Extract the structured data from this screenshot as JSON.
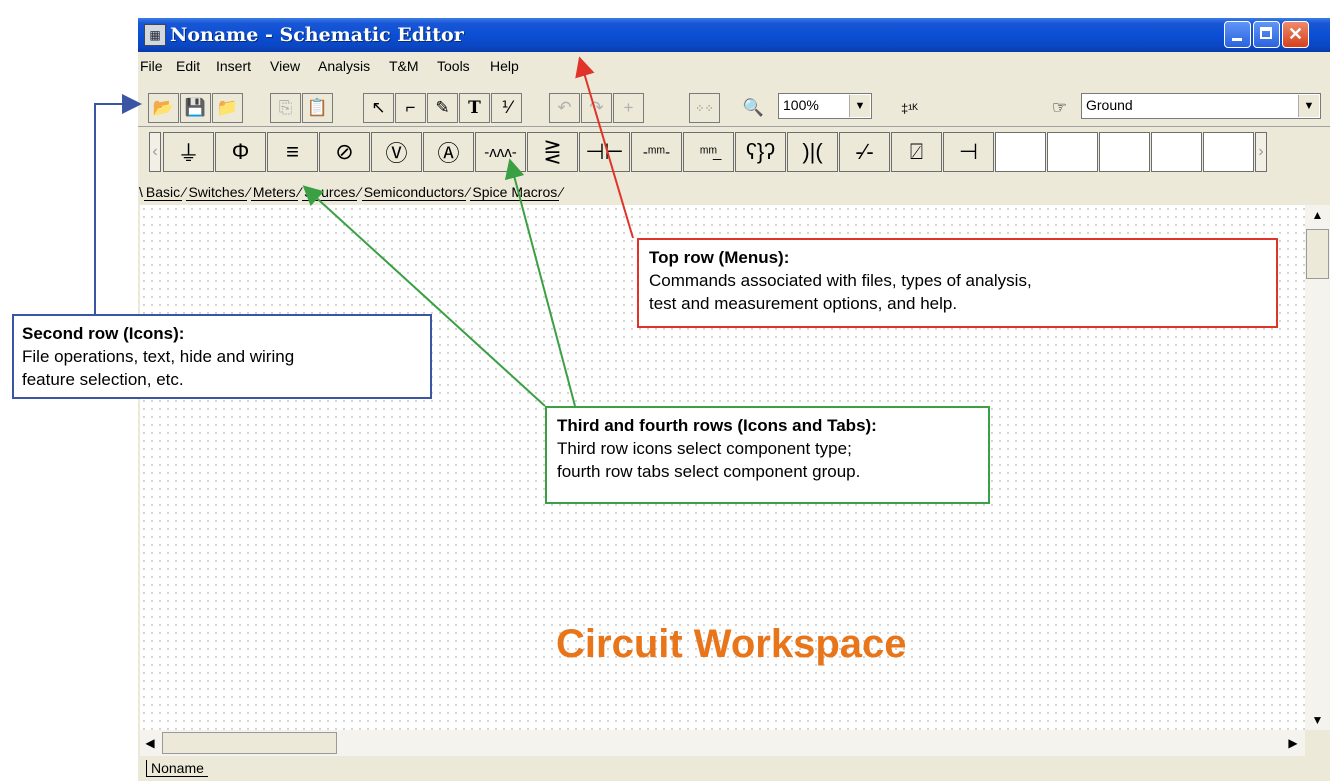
{
  "window": {
    "title": "Noname - Schematic Editor",
    "title_icon": "app-icon",
    "controls": [
      "minimize-icon",
      "maximize-icon",
      "close-icon"
    ]
  },
  "menu": {
    "items": [
      "File",
      "Edit",
      "Insert",
      "View",
      "Analysis",
      "T&M",
      "Tools",
      "Help"
    ]
  },
  "toolbar": {
    "zoom_value": "100%",
    "component_value": "Ground",
    "tool_icons": [
      "open-folder",
      "save",
      "open",
      "copy",
      "paste",
      "pointer",
      "wire",
      "pencil",
      "text",
      "hide-toggle",
      "undo",
      "redo",
      "junction",
      "grid",
      "zoom",
      "resistor-value"
    ]
  },
  "component_bar": {
    "icons": [
      "ground",
      "dc-source",
      "battery",
      "ac-source",
      "voltmeter",
      "ammeter",
      "resistor",
      "variable-resistor",
      "capacitor",
      "inductor",
      "inductor-core",
      "transformer",
      "transformer-2",
      "switch",
      "potentiometer",
      "connector"
    ]
  },
  "tabs": [
    "Basic",
    "Switches",
    "Meters",
    "Sources",
    "Semiconductors",
    "Spice Macros"
  ],
  "bottom_tab": "Noname",
  "workspace_label": "Circuit Workspace",
  "callouts": {
    "menus": {
      "title": "Top row (Menus):",
      "line1": "Commands associated with files, types of analysis,",
      "line2": "test and measurement options, and help."
    },
    "icons": {
      "title": "Second row (Icons):",
      "line1": "File operations, text, hide and wiring",
      "line2": "feature selection, etc."
    },
    "components": {
      "title": "Third and fourth rows (Icons and Tabs):",
      "line1": "Third row icons select component type;",
      "line2": "fourth row tabs select component group."
    }
  },
  "colors": {
    "titlebar": "#0b4fd4",
    "menus_callout": "#e0332a",
    "icons_callout": "#3a55a4",
    "components_callout": "#3aa043",
    "workspace_label": "#e8751a"
  }
}
